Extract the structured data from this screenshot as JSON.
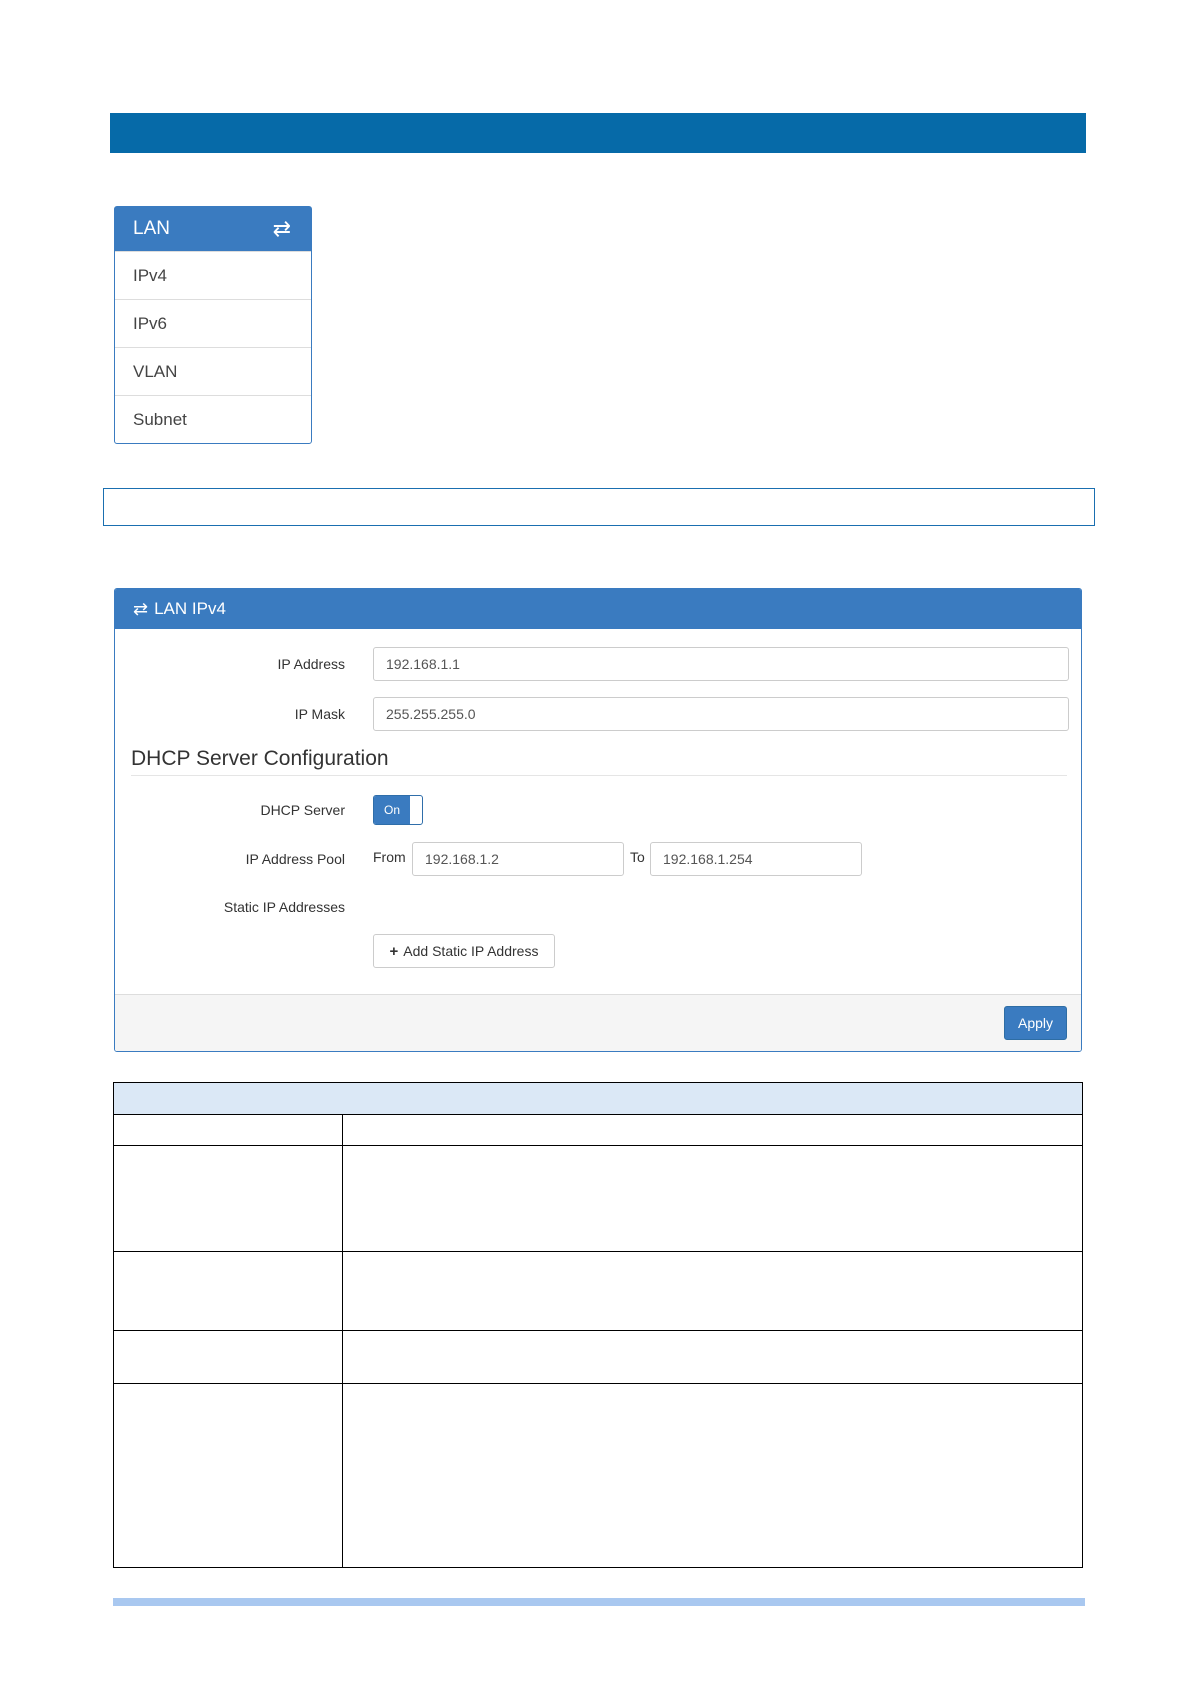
{
  "lan_menu": {
    "title": "LAN",
    "title_icon": "transfer-icon",
    "items": [
      {
        "label": "IPv4"
      },
      {
        "label": "IPv6"
      },
      {
        "label": "VLAN"
      },
      {
        "label": "Subnet"
      }
    ]
  },
  "panel": {
    "title": "LAN IPv4",
    "title_icon": "transfer-icon",
    "ip_address_label": "IP Address",
    "ip_address_value": "192.168.1.1",
    "ip_mask_label": "IP Mask",
    "ip_mask_value": "255.255.255.0",
    "dhcp_section_title": "DHCP Server Configuration",
    "dhcp_server_label": "DHCP Server",
    "dhcp_server_state": "On",
    "pool_label": "IP Address Pool",
    "pool_from_label": "From",
    "pool_from_value": "192.168.1.2",
    "pool_to_label": "To",
    "pool_to_value": "192.168.1.254",
    "static_label": "Static IP Addresses",
    "add_static_label": "Add Static IP Address",
    "apply_label": "Apply"
  },
  "colors": {
    "header_bar": "#066aa8",
    "panel_blue": "#3a7bc0",
    "table_header": "#dbe8f6",
    "bottom_strip": "#a9c8f0"
  }
}
